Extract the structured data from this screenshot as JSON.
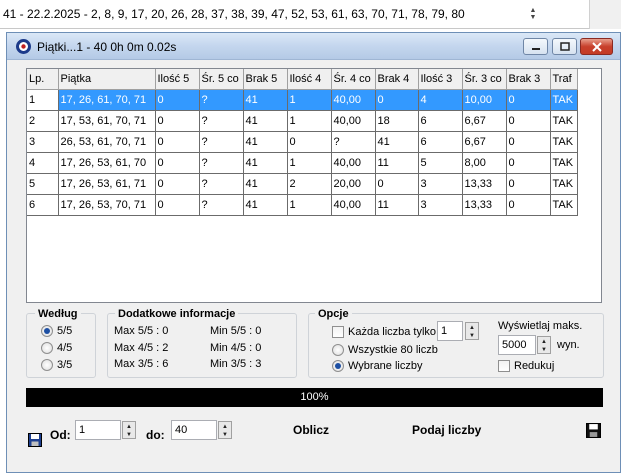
{
  "top_combo": {
    "text": "41 - 22.2.2025 - 2, 8, 9, 17, 20, 26, 28, 37, 38, 39, 47, 52, 53, 61, 63, 70, 71, 78, 79, 80"
  },
  "window": {
    "title": "Piątki...1 - 40   0h 0m 0.02s"
  },
  "table": {
    "columns": [
      "Lp.",
      "Piątka",
      "Ilość 5",
      "Śr. 5 co",
      "Brak 5",
      "Ilość 4",
      "Śr. 4 co",
      "Brak 4",
      "Ilość 3",
      "Śr. 3 co",
      "Brak 3",
      "Traf"
    ],
    "rows": [
      [
        "1",
        "17, 26, 61, 70, 71",
        "0",
        "?",
        "41",
        "1",
        "40,00",
        "0",
        "4",
        "10,00",
        "0",
        "TAK"
      ],
      [
        "2",
        "17, 53, 61, 70, 71",
        "0",
        "?",
        "41",
        "1",
        "40,00",
        "18",
        "6",
        "6,67",
        "0",
        "TAK"
      ],
      [
        "3",
        "26, 53, 61, 70, 71",
        "0",
        "?",
        "41",
        "0",
        "?",
        "41",
        "6",
        "6,67",
        "0",
        "TAK"
      ],
      [
        "4",
        "17, 26, 53, 61, 70",
        "0",
        "?",
        "41",
        "1",
        "40,00",
        "11",
        "5",
        "8,00",
        "0",
        "TAK"
      ],
      [
        "5",
        "17, 26, 53, 61, 71",
        "0",
        "?",
        "41",
        "2",
        "20,00",
        "0",
        "3",
        "13,33",
        "0",
        "TAK"
      ],
      [
        "6",
        "17, 26, 53, 70, 71",
        "0",
        "?",
        "41",
        "1",
        "40,00",
        "11",
        "3",
        "13,33",
        "0",
        "TAK"
      ]
    ]
  },
  "wedlug": {
    "label": "Według",
    "options": [
      "5/5",
      "4/5",
      "3/5"
    ],
    "selected": "5/5"
  },
  "dodatkowe": {
    "label": "Dodatkowe informacje",
    "left": [
      "Max 5/5 : 0",
      "Max 4/5 : 2",
      "Max 3/5 : 6"
    ],
    "right": [
      "Min 5/5 :  0",
      "Min 4/5 :  0",
      "Min 3/5 :  3"
    ]
  },
  "opcje": {
    "label": "Opcje",
    "kazda_label": "Każda liczba tylko",
    "kazda_value": "1",
    "wszystkie_label": "Wszystkie 80 liczb",
    "wybrane_label": "Wybrane liczby",
    "selected": "Wybrane liczby",
    "wyswietlaj_label": "Wyświetlaj maks.",
    "wyswietlaj_value": "5000",
    "wyn_label": "wyn.",
    "redukuj_label": "Redukuj"
  },
  "progress": {
    "text": "100%",
    "value": 1.0
  },
  "bottom": {
    "od_label": "Od:",
    "od_value": "1",
    "do_label": "do:",
    "do_value": "40",
    "oblicz_label": "Oblicz",
    "podaj_label": "Podaj liczby"
  },
  "colors": {
    "selection": "#3399ff",
    "progress_bg": "#000000"
  }
}
